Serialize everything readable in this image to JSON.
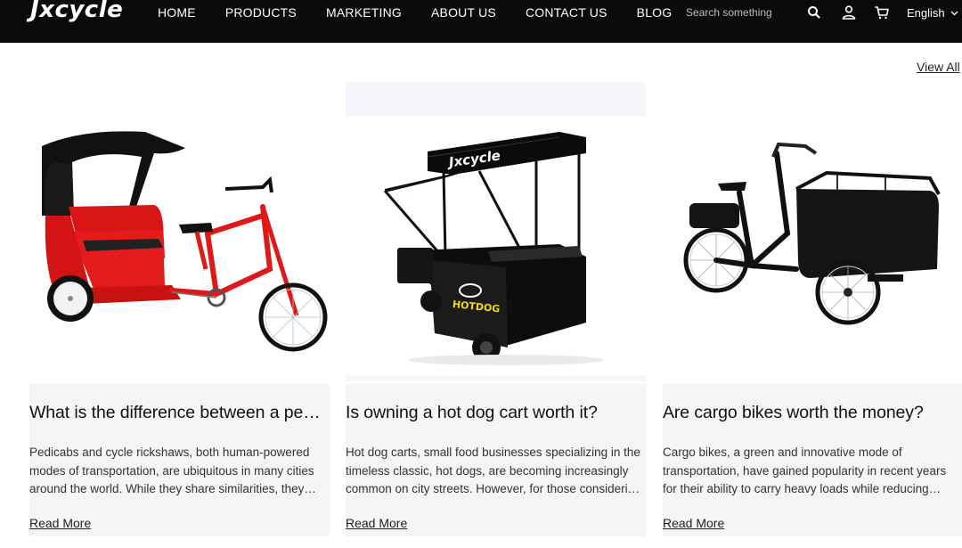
{
  "header": {
    "logo": "Jxcycle",
    "nav": [
      "HOME",
      "PRODUCTS",
      "MARKETING",
      "ABOUT US",
      "CONTACT US",
      "BLOG"
    ],
    "search_placeholder": "Search something",
    "language": "English",
    "icons": [
      "search-icon",
      "user-icon",
      "cart-icon",
      "chevron-down-icon"
    ]
  },
  "view_all": "View All",
  "posts": [
    {
      "title": "What is the difference between a pedicab and a cycle rickshaw?",
      "excerpt": "Pedicabs and cycle rickshaws, both human-powered modes of transportation, are ubiquitous in many cities around the world. While they share similarities, they differ in several key aspects.",
      "read_more": "Read More",
      "image": "red-pedicab"
    },
    {
      "title": "Is owning a hot dog cart worth it?",
      "excerpt": "Hot dog carts, small food businesses specializing in the timeless classic, hot dogs, are becoming increasingly common on city streets. However, for those considering starting one, the question remains.",
      "read_more": "Read More",
      "image": "hotdog-cart",
      "cart_brand": "Jxcycle",
      "cart_label": "HOTDOG"
    },
    {
      "title": "Are cargo bikes worth the money?",
      "excerpt": "Cargo bikes, a green and innovative mode of transportation, have gained popularity in recent years for their ability to carry heavy loads while reducing emissions.",
      "read_more": "Read More",
      "image": "black-cargo-bike"
    }
  ]
}
